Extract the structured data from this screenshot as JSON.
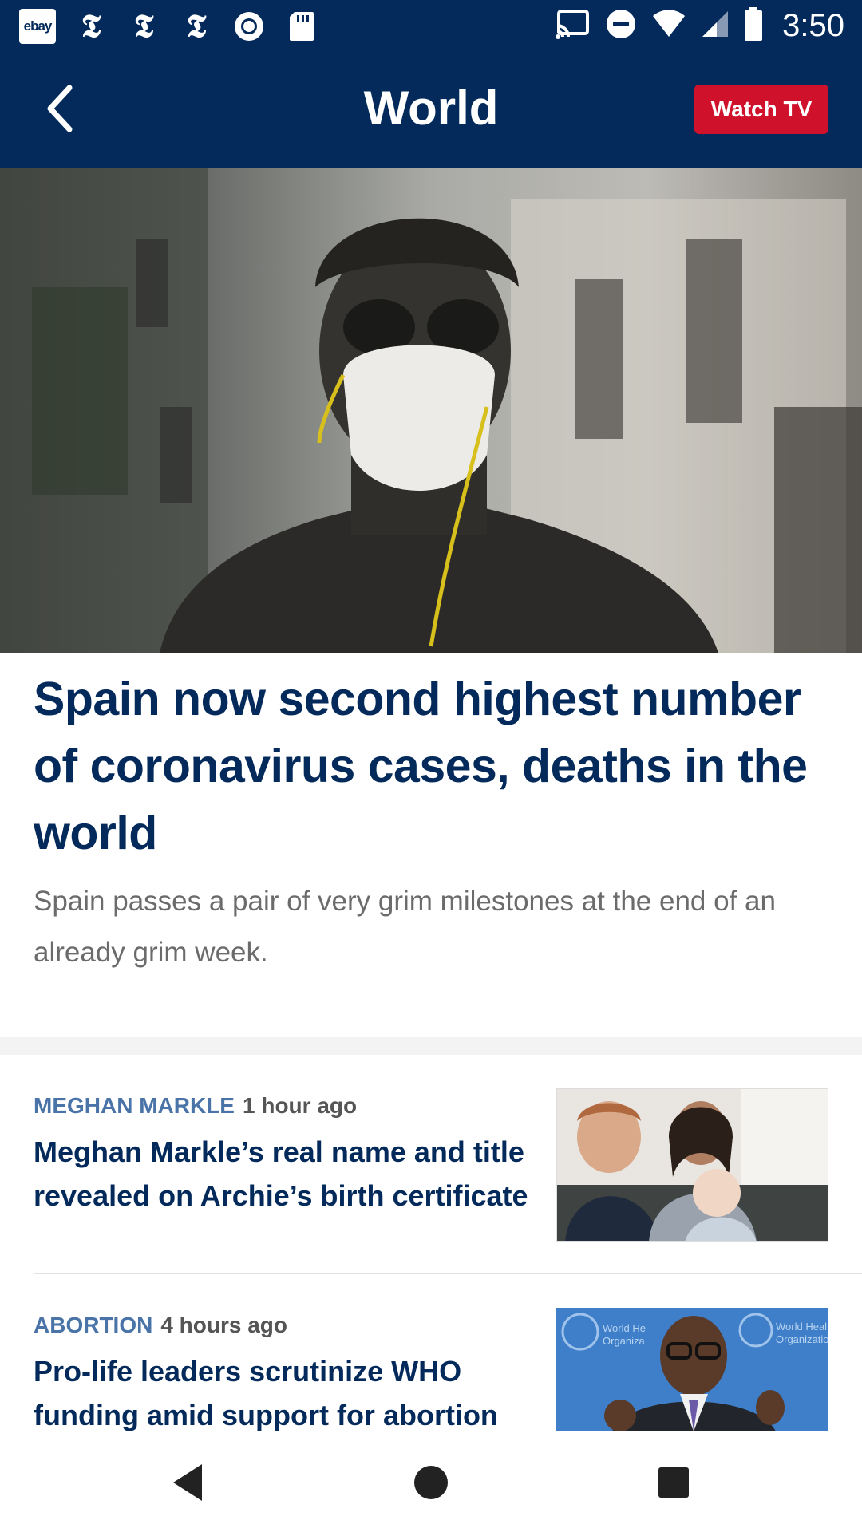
{
  "status_bar": {
    "app_icons": [
      "ebay-icon",
      "nyt-icon",
      "nyt-icon",
      "nyt-icon",
      "record-icon",
      "sd-card-icon"
    ],
    "ebay_text": "ebay",
    "nyt_glyph": "𝕿",
    "system_icons": [
      "cast-icon",
      "do-not-disturb-icon",
      "wifi-icon",
      "signal-icon",
      "battery-icon"
    ],
    "time": "3:50"
  },
  "app_bar": {
    "back_icon": "chevron-left-icon",
    "title": "World",
    "watch_tv_label": "Watch TV",
    "bg_color": "#032a5a",
    "accent_color": "#d0112b"
  },
  "hero": {
    "image_alt": "statue with face mask",
    "headline": "Spain now second highest number of coronavirus cases, deaths in the world",
    "summary": "Spain passes a pair of very grim milestones at the end of an already grim week."
  },
  "stories": [
    {
      "tag": "MEGHAN MARKLE",
      "time": "1 hour ago",
      "title": "Meghan Markle’s real name and title revealed on Archie’s birth certificate"
    },
    {
      "tag": "ABORTION",
      "time": "4 hours ago",
      "title": "Pro-life leaders scrutinize WHO funding amid support for abortion",
      "thumb_text_left": "World He\nOrganiza",
      "thumb_text_right": "World Health\nOrganization"
    }
  ],
  "nav_bar": {
    "buttons": [
      "back-triangle-icon",
      "home-circle-icon",
      "recents-square-icon"
    ]
  }
}
